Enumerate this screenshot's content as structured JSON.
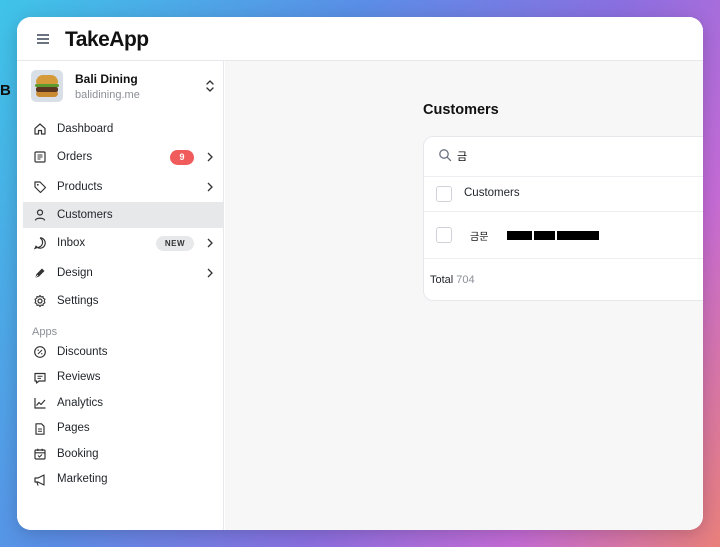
{
  "app": {
    "logo": "TakeApp"
  },
  "store": {
    "name": "Bali Dining",
    "domain": "balidining.me"
  },
  "nav": {
    "items": [
      {
        "label": "Dashboard",
        "icon": "home-icon"
      },
      {
        "label": "Orders",
        "icon": "receipt-icon",
        "badge": "9"
      },
      {
        "label": "Products",
        "icon": "tag-icon"
      },
      {
        "label": "Customers",
        "icon": "user-icon",
        "active": true
      },
      {
        "label": "Inbox",
        "icon": "whatsapp-icon",
        "badge": "NEW"
      },
      {
        "label": "Design",
        "icon": "pen-icon"
      },
      {
        "label": "Settings",
        "icon": "gear-icon"
      }
    ]
  },
  "apps": {
    "title": "Apps",
    "items": [
      {
        "label": "Discounts",
        "icon": "percent-icon"
      },
      {
        "label": "Reviews",
        "icon": "message-icon"
      },
      {
        "label": "Analytics",
        "icon": "chart-line-icon"
      },
      {
        "label": "Pages",
        "icon": "file-icon"
      },
      {
        "label": "Booking",
        "icon": "calendar-icon"
      },
      {
        "label": "Marketing",
        "icon": "megaphone-icon"
      }
    ]
  },
  "main": {
    "title": "Customers",
    "search": {
      "value": "금"
    },
    "table": {
      "header": "Customers",
      "rows": [
        {
          "name": "금문"
        }
      ]
    },
    "total": {
      "label": "Total",
      "count": "704"
    }
  },
  "colors": {
    "badge_red": "#f05c5c",
    "active_bg": "#e7e8ea"
  }
}
